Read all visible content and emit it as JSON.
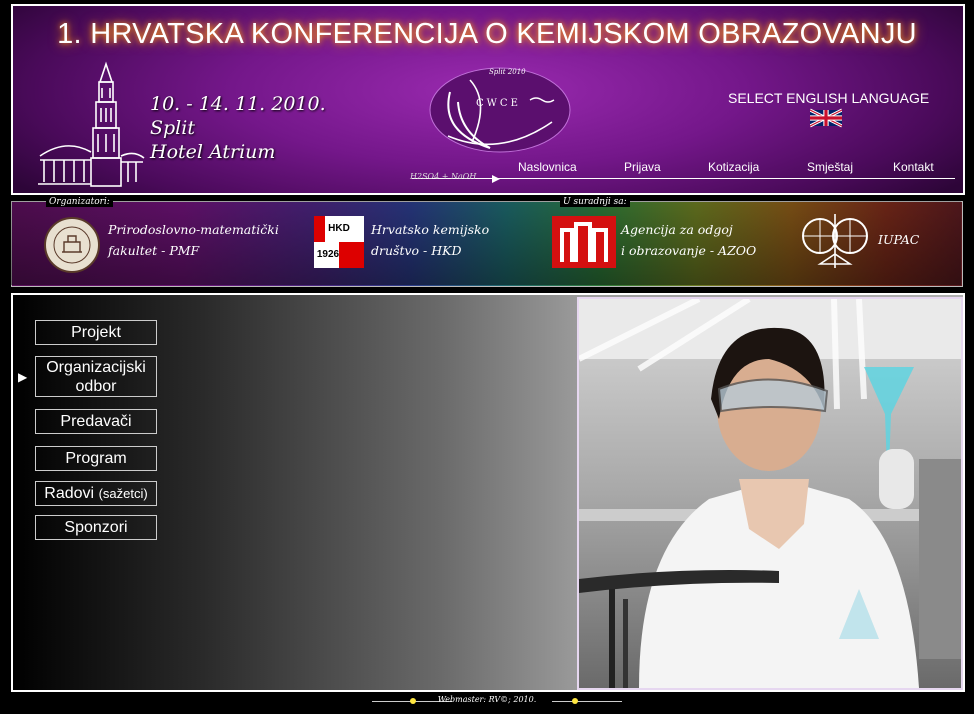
{
  "header": {
    "title": "1. HRVATSKA KONFERENCIJA O KEMIJSKOM OBRAZOVANJU",
    "dates_line": "10. - 14. 11. 2010.",
    "city": "Split",
    "venue": "Hotel Atrium",
    "logo_top": "Split 2010",
    "logo_text": "CWCE",
    "formula": "H2SO4 + NaOH",
    "english_link": "SELECT ENGLISH LANGUAGE",
    "nav": [
      "Naslovnica",
      "Prijava",
      "Kotizacija",
      "Smještaj",
      "Kontakt"
    ]
  },
  "band": {
    "organizers_label": "Organizatori:",
    "partners_label": "U suradnji sa:",
    "pmf": {
      "line1": "Prirodoslovno-matematički",
      "line2": "fakultet - PMF"
    },
    "hkd": {
      "line1": "Hrvatsko kemijsko",
      "line2": "društvo - HKD",
      "badge_top": "HKD",
      "badge_year": "1926"
    },
    "azoo": {
      "line1": "Agencija za odgoj",
      "line2": "i obrazovanje - AZOO"
    },
    "iupac": {
      "label": "IUPAC"
    }
  },
  "menu": [
    {
      "label": "Projekt",
      "selected": false
    },
    {
      "label": "Organizacijski odbor",
      "line1": "Organizacijski",
      "line2": "odbor",
      "selected": true
    },
    {
      "label": "Predavači",
      "selected": false
    },
    {
      "label": "Program",
      "selected": false
    },
    {
      "label": "Radovi",
      "sub": "(sažetci)",
      "selected": false
    },
    {
      "label": "Sponzori",
      "selected": false
    }
  ],
  "footer": {
    "text": "Webmaster: RV©; 2010."
  },
  "colors": {
    "glow": "#ff9a20",
    "footer_dot": "#ffe640",
    "photo_border": "#e6d7f0"
  }
}
